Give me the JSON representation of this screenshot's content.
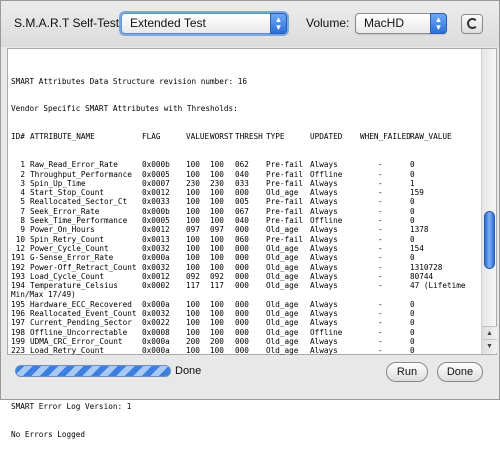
{
  "toolbar": {
    "self_test_label": "S.M.A.R.T Self-Test:",
    "test_selected": "Extended Test",
    "volume_label": "Volume:",
    "volume_selected": "MacHD",
    "refresh_glyph": "G"
  },
  "output": {
    "header_lines": [
      "SMART Attributes Data Structure revision number: 16",
      "Vendor Specific SMART Attributes with Thresholds:"
    ],
    "columns": [
      "ID#",
      "ATTRIBUTE_NAME",
      "FLAG",
      "VALUE",
      "WORST",
      "THRESH",
      "TYPE",
      "UPDATED",
      "WHEN_FAILED",
      "RAW_VALUE"
    ],
    "rows": [
      [
        "1",
        "Raw_Read_Error_Rate",
        "0x000b",
        "100",
        "100",
        "062",
        "Pre-fail",
        "Always",
        "-",
        "0"
      ],
      [
        "2",
        "Throughput_Performance",
        "0x0005",
        "100",
        "100",
        "040",
        "Pre-fail",
        "Offline",
        "-",
        "0"
      ],
      [
        "3",
        "Spin_Up_Time",
        "0x0007",
        "230",
        "230",
        "033",
        "Pre-fail",
        "Always",
        "-",
        "1"
      ],
      [
        "4",
        "Start_Stop_Count",
        "0x0012",
        "100",
        "100",
        "000",
        "Old_age",
        "Always",
        "-",
        "159"
      ],
      [
        "5",
        "Reallocated_Sector_Ct",
        "0x0033",
        "100",
        "100",
        "005",
        "Pre-fail",
        "Always",
        "-",
        "0"
      ],
      [
        "7",
        "Seek_Error_Rate",
        "0x000b",
        "100",
        "100",
        "067",
        "Pre-fail",
        "Always",
        "-",
        "0"
      ],
      [
        "8",
        "Seek_Time_Performance",
        "0x0005",
        "100",
        "100",
        "040",
        "Pre-fail",
        "Offline",
        "-",
        "0"
      ],
      [
        "9",
        "Power_On_Hours",
        "0x0012",
        "097",
        "097",
        "000",
        "Old_age",
        "Always",
        "-",
        "1378"
      ],
      [
        "10",
        "Spin_Retry_Count",
        "0x0013",
        "100",
        "100",
        "060",
        "Pre-fail",
        "Always",
        "-",
        "0"
      ],
      [
        "12",
        "Power_Cycle_Count",
        "0x0032",
        "100",
        "100",
        "000",
        "Old_age",
        "Always",
        "-",
        "154"
      ],
      [
        "191",
        "G-Sense_Error_Rate",
        "0x000a",
        "100",
        "100",
        "000",
        "Old_age",
        "Always",
        "-",
        "0"
      ],
      [
        "192",
        "Power-Off_Retract_Count",
        "0x0032",
        "100",
        "100",
        "000",
        "Old_age",
        "Always",
        "-",
        "1310728"
      ],
      [
        "193",
        "Load_Cycle_Count",
        "0x0012",
        "092",
        "092",
        "000",
        "Old_age",
        "Always",
        "-",
        "80744"
      ],
      [
        "194",
        "Temperature_Celsius",
        "0x0002",
        "117",
        "117",
        "000",
        "Old_age",
        "Always",
        "-",
        "47 (Lifetime"
      ],
      [
        "195",
        "Hardware_ECC_Recovered",
        "0x000a",
        "100",
        "100",
        "000",
        "Old_age",
        "Always",
        "-",
        "0"
      ],
      [
        "196",
        "Reallocated_Event_Count",
        "0x0032",
        "100",
        "100",
        "000",
        "Old_age",
        "Always",
        "-",
        "0"
      ],
      [
        "197",
        "Current_Pending_Sector",
        "0x0022",
        "100",
        "100",
        "000",
        "Old_age",
        "Always",
        "-",
        "0"
      ],
      [
        "198",
        "Offline_Uncorrectable",
        "0x0008",
        "100",
        "100",
        "000",
        "Old_age",
        "Offline",
        "-",
        "0"
      ],
      [
        "199",
        "UDMA_CRC_Error_Count",
        "0x000a",
        "200",
        "200",
        "000",
        "Old_age",
        "Always",
        "-",
        "0"
      ],
      [
        "223",
        "Load_Retry_Count",
        "0x000a",
        "100",
        "100",
        "000",
        "Old_age",
        "Always",
        "-",
        "0"
      ]
    ],
    "temp_continuation": "Min/Max 17/49)",
    "error_log_version": "SMART Error Log Version: 1",
    "errors_status": "No Errors Logged"
  },
  "bottom": {
    "status": "Done",
    "run_label": "Run",
    "done_label": "Done"
  },
  "colors": {
    "accent": "#2b6fdc",
    "window_bg": "#e8e8e8"
  }
}
